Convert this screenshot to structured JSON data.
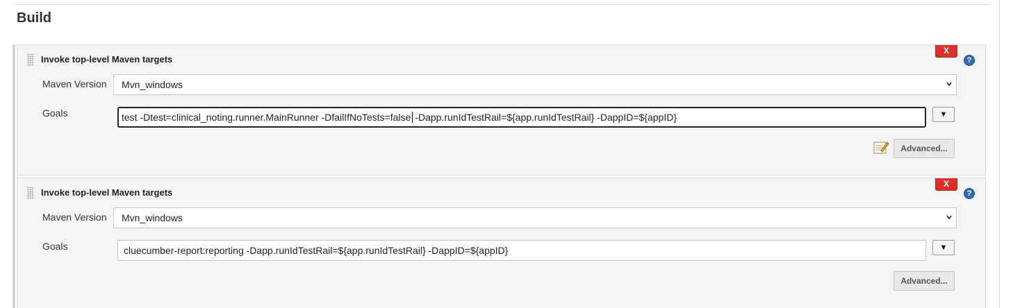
{
  "section": {
    "title": "Build"
  },
  "icons": {
    "delete": "x-icon",
    "help": "question-mark-icon",
    "notepad": "notepad-icon",
    "expand": "triangle-down-icon",
    "select": "chevron-down-icon"
  },
  "colors": {
    "delete_button": "#d9312b",
    "help_icon": "#2d6ba9",
    "panel_bg": "#f4f4f4"
  },
  "steps": [
    {
      "title": "Invoke top-level Maven targets",
      "delete_label": "X",
      "help_label": "?",
      "maven_version_label": "Maven Version",
      "maven_version_value": "Mvn_windows",
      "goals_label": "Goals",
      "goals_value_before_caret": "test -Dtest=clinical_noting.runner.MainRunner -DfailIfNoTests=false",
      "goals_value_after_caret": "-Dapp.runIdTestRail=${app.runIdTestRail} -DappID=${appID}",
      "expand_label": "▼",
      "advanced_label": "Advanced..."
    },
    {
      "title": "Invoke top-level Maven targets",
      "delete_label": "X",
      "help_label": "?",
      "maven_version_label": "Maven Version",
      "maven_version_value": "Mvn_windows",
      "goals_label": "Goals",
      "goals_value": "cluecumber-report:reporting -Dapp.runIdTestRail=${app.runIdTestRail} -DappID=${appID}",
      "expand_label": "▼",
      "advanced_label": "Advanced..."
    }
  ]
}
